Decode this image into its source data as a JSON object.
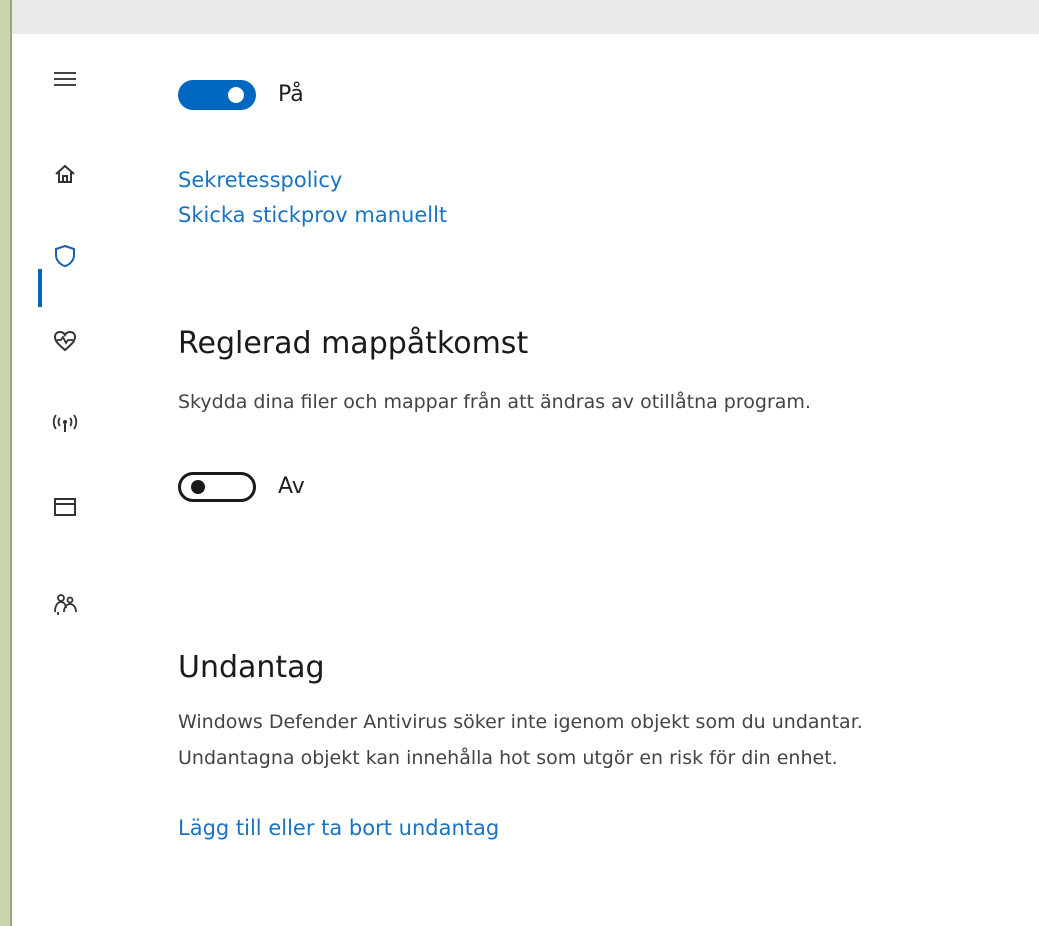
{
  "sidebar": {
    "items": [
      {
        "name": "menu",
        "icon": "hamburger-menu-icon",
        "active": false
      },
      {
        "name": "home",
        "icon": "home-icon",
        "active": false
      },
      {
        "name": "virus-protection",
        "icon": "shield-icon",
        "active": true
      },
      {
        "name": "device-health",
        "icon": "heart-pulse-icon",
        "active": false
      },
      {
        "name": "network",
        "icon": "wireless-signal-icon",
        "active": false
      },
      {
        "name": "app-browser",
        "icon": "browser-window-icon",
        "active": false
      },
      {
        "name": "family",
        "icon": "family-icon",
        "active": false
      }
    ],
    "accent": "#0067c0"
  },
  "cloud_protection": {
    "toggle_state": "on",
    "toggle_label": "På"
  },
  "links": {
    "privacy_policy": "Sekretesspolicy",
    "submit_sample": "Skicka stickprov manuellt"
  },
  "controlled_folder_access": {
    "title": "Reglerad mappåtkomst",
    "description": "Skydda dina filer och mappar från att ändras av otillåtna program.",
    "toggle_state": "off",
    "toggle_label": "Av"
  },
  "exclusions": {
    "title": "Undantag",
    "description_line1": "Windows Defender Antivirus söker inte igenom objekt som du undantar.",
    "description_line2": "Undantagna objekt kan innehålla hot som utgör en risk för din enhet.",
    "link": "Lägg till eller ta bort undantag"
  },
  "colors": {
    "accent": "#0067c0",
    "link": "#1a73c2"
  }
}
